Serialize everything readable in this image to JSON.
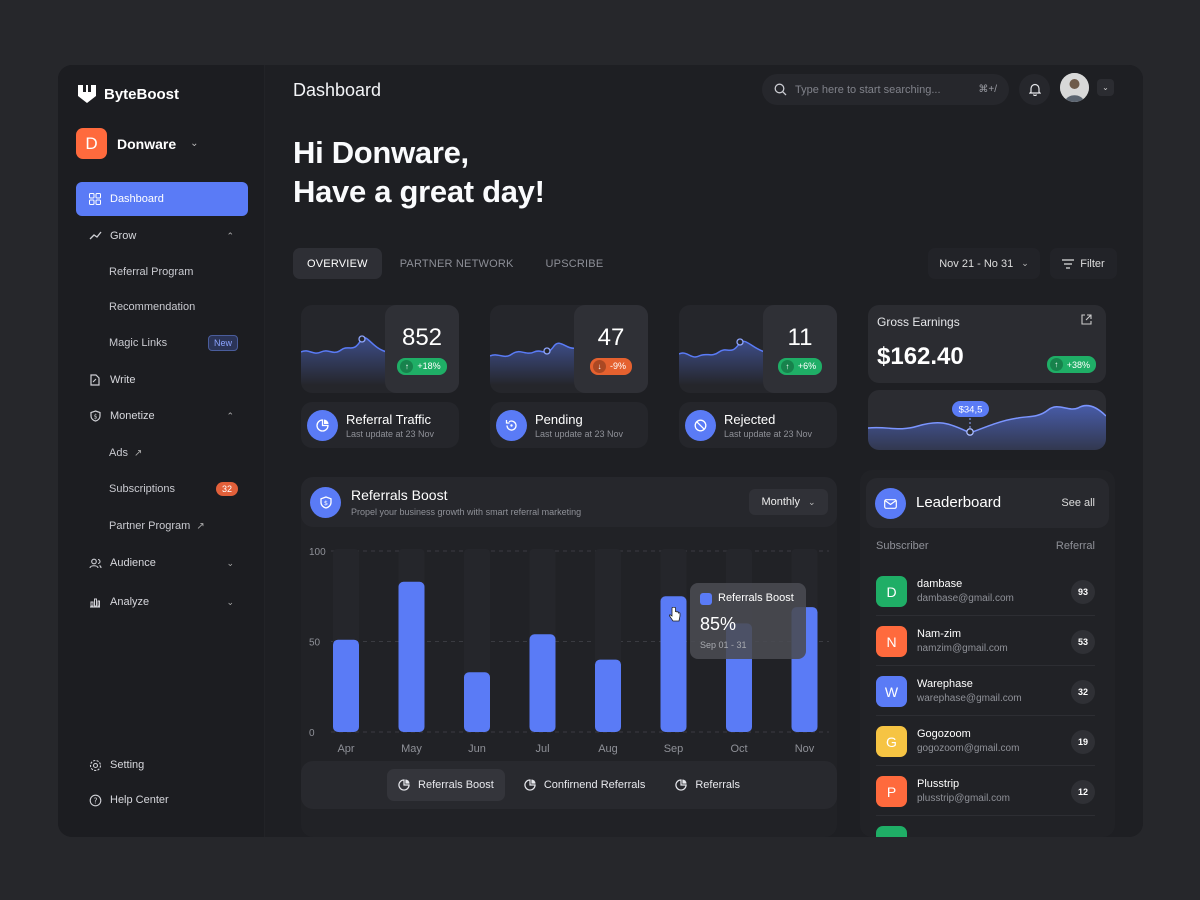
{
  "app": {
    "name": "ByteBoost"
  },
  "workspace": {
    "initial": "D",
    "name": "Donware"
  },
  "sidebar": {
    "items": [
      {
        "label": "Dashboard",
        "icon": "grid-icon",
        "active": true
      },
      {
        "label": "Grow",
        "icon": "trend-icon"
      },
      {
        "label": "Referral Program",
        "sub": true
      },
      {
        "label": "Recommendation",
        "sub": true
      },
      {
        "label": "Magic Links",
        "sub": true,
        "badge": "New"
      },
      {
        "label": "Write",
        "icon": "doc-icon"
      },
      {
        "label": "Monetize",
        "icon": "shield-icon"
      },
      {
        "label": "Ads",
        "sub": true
      },
      {
        "label": "Subscriptions",
        "sub": true,
        "count": "32"
      },
      {
        "label": "Partner Program",
        "sub": true
      },
      {
        "label": "Audience",
        "icon": "users-icon"
      },
      {
        "label": "Analyze",
        "icon": "bar-chart-icon"
      }
    ],
    "footer": [
      {
        "label": "Setting",
        "icon": "gear-icon"
      },
      {
        "label": "Help Center",
        "icon": "help-icon"
      }
    ]
  },
  "header": {
    "title": "Dashboard",
    "search_placeholder": "Type here to start searching...",
    "shortcut": "⌘+/"
  },
  "greeting": {
    "line1": "Hi Donware,",
    "line2": "Have a great day!"
  },
  "tabs": [
    "OVERVIEW",
    "PARTNER NETWORK",
    "UPSCRIBE"
  ],
  "date_range": "Nov 21 - No 31",
  "filter_label": "Filter",
  "stats": [
    {
      "value": "852",
      "change": "+18%",
      "direction": "up",
      "label": "Referral Traffic",
      "sub": "Last update at 23 Nov"
    },
    {
      "value": "47",
      "change": "-9%",
      "direction": "down",
      "label": "Pending",
      "sub": "Last update at 23 Nov"
    },
    {
      "value": "11",
      "change": "+6%",
      "direction": "up",
      "label": "Rejected",
      "sub": "Last update at 23 Nov"
    }
  ],
  "gross": {
    "title": "Gross Earnings",
    "amount": "$162.40",
    "change": "+38%",
    "marker": "$34,5"
  },
  "referrals_boost": {
    "title": "Referrals Boost",
    "subtitle": "Propel your business growth with smart referral marketing",
    "period": "Monthly",
    "tooltip": {
      "name": "Referrals Boost",
      "value": "85%",
      "range": "Sep 01 - 31"
    },
    "legend": [
      "Referrals Boost",
      "Confirnend Referrals",
      "Referrals"
    ]
  },
  "chart_data": {
    "type": "bar",
    "categories": [
      "Apr",
      "May",
      "Jun",
      "Jul",
      "Aug",
      "Sep",
      "Oct",
      "Nov"
    ],
    "values": [
      51,
      83,
      33,
      54,
      40,
      75,
      60,
      69
    ],
    "ylim": [
      0,
      100
    ],
    "yticks": [
      "100",
      "50",
      "0"
    ],
    "color": "#5a7bf6"
  },
  "leaderboard": {
    "title": "Leaderboard",
    "see_all": "See all",
    "col_subscriber": "Subscriber",
    "col_referral": "Referral",
    "rows": [
      {
        "initial": "D",
        "name": "dambase",
        "email": "dambase@gmail.com",
        "count": "93",
        "color": "#1fae66"
      },
      {
        "initial": "N",
        "name": "Nam-zim",
        "email": "namzim@gmail.com",
        "count": "53",
        "color": "#ff6a3d"
      },
      {
        "initial": "W",
        "name": "Warephase",
        "email": "warephase@gmail.com",
        "count": "32",
        "color": "#5a7bf6"
      },
      {
        "initial": "G",
        "name": "Gogozoom",
        "email": "gogozoom@gmail.com",
        "count": "19",
        "color": "#f6c443"
      },
      {
        "initial": "P",
        "name": "Plusstrip",
        "email": "plusstrip@gmail.com",
        "count": "12",
        "color": "#ff6a3d"
      }
    ]
  }
}
